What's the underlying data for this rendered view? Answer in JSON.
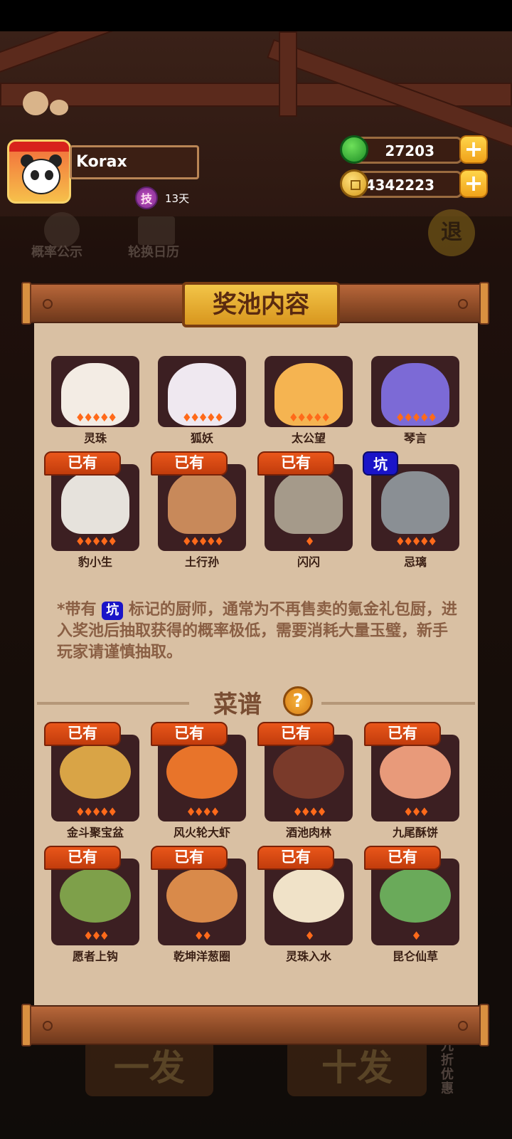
{
  "profile": {
    "name": "Korax",
    "skill_badge": "技",
    "days": "13天"
  },
  "currency": {
    "jade": {
      "icon": "jade-icon",
      "value": "27203"
    },
    "coins": {
      "icon": "coin-icon",
      "value": "4342223"
    },
    "plus": "+"
  },
  "background_buttons": {
    "probability": "概率公示",
    "calendar": "轮换日历",
    "back": "退",
    "pull_once": "一发",
    "pull_ten": "十发",
    "discount": "九折优惠"
  },
  "panel": {
    "title": "奖池内容",
    "owned_tag": "已有",
    "pit_tag": "坑",
    "chefs": [
      {
        "name": "灵珠",
        "stars": 5,
        "owned": false,
        "pit": false,
        "color": "#f3ece4"
      },
      {
        "name": "狐妖",
        "stars": 5,
        "owned": false,
        "pit": false,
        "color": "#efe8f0"
      },
      {
        "name": "太公望",
        "stars": 5,
        "owned": false,
        "pit": false,
        "color": "#f5b451"
      },
      {
        "name": "琴言",
        "stars": 5,
        "owned": false,
        "pit": false,
        "color": "#7c6ad6"
      },
      {
        "name": "豹小生",
        "stars": 5,
        "owned": true,
        "pit": false,
        "color": "#e6e2dc"
      },
      {
        "name": "土行孙",
        "stars": 5,
        "owned": true,
        "pit": false,
        "color": "#c8895a"
      },
      {
        "name": "闪闪",
        "stars": 1,
        "owned": true,
        "pit": false,
        "color": "#a59a8a"
      },
      {
        "name": "忌璃",
        "stars": 5,
        "owned": false,
        "pit": true,
        "color": "#8a8f94"
      }
    ],
    "note_prefix": "*带有",
    "note_pit": "坑",
    "note_text": "标记的厨师，通常为不再售卖的氪金礼包厨，进入奖池后抽取获得的概率极低，需要消耗大量玉璧，新手玩家请谨慎抽取。",
    "recipes_title": "菜谱",
    "help": "?",
    "recipes": [
      {
        "name": "金斗聚宝盆",
        "stars": 5,
        "owned": true,
        "color": "#d9a446"
      },
      {
        "name": "风火轮大虾",
        "stars": 4,
        "owned": true,
        "color": "#e8742a"
      },
      {
        "name": "酒池肉林",
        "stars": 4,
        "owned": true,
        "color": "#7a3a2a"
      },
      {
        "name": "九尾酥饼",
        "stars": 3,
        "owned": true,
        "color": "#e89a7a"
      },
      {
        "name": "愿者上钩",
        "stars": 3,
        "owned": true,
        "color": "#7ea04a"
      },
      {
        "name": "乾坤洋葱圈",
        "stars": 2,
        "owned": true,
        "color": "#d98a4a"
      },
      {
        "name": "灵珠入水",
        "stars": 1,
        "owned": true,
        "color": "#f0e2c8"
      },
      {
        "name": "昆仑仙草",
        "stars": 1,
        "owned": true,
        "color": "#6aaa5a"
      }
    ]
  }
}
